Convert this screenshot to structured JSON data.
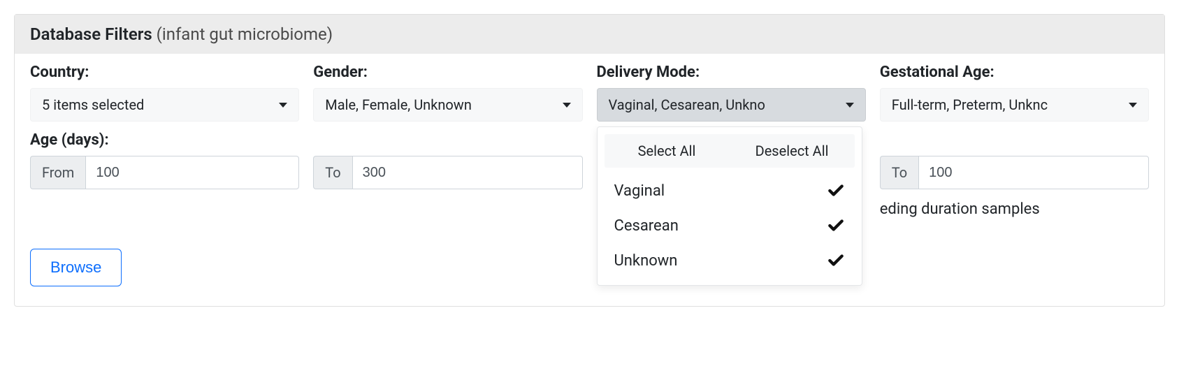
{
  "header": {
    "title_strong": "Database Filters",
    "title_context": "(infant gut microbiome)"
  },
  "filters": {
    "country": {
      "label": "Country:",
      "selected_text": "5 items selected"
    },
    "gender": {
      "label": "Gender:",
      "selected_text": "Male, Female, Unknown"
    },
    "delivery_mode": {
      "label": "Delivery Mode:",
      "selected_text": "Vaginal, Cesarean, Unkno",
      "menu": {
        "select_all": "Select All",
        "deselect_all": "Deselect All",
        "options": [
          {
            "label": "Vaginal",
            "checked": true
          },
          {
            "label": "Cesarean",
            "checked": true
          },
          {
            "label": "Unknown",
            "checked": true
          }
        ]
      }
    },
    "gestational_age": {
      "label": "Gestational Age:",
      "selected_text": "Full-term, Preterm, Unknc"
    }
  },
  "age_days": {
    "label": "Age (days):",
    "from_addon": "From",
    "from_value": "100",
    "to_addon": "To",
    "to_value": "300"
  },
  "right_range": {
    "to_addon": "To",
    "to_value": "100"
  },
  "partial_text_visible": "eding duration samples",
  "browse_label": "Browse"
}
